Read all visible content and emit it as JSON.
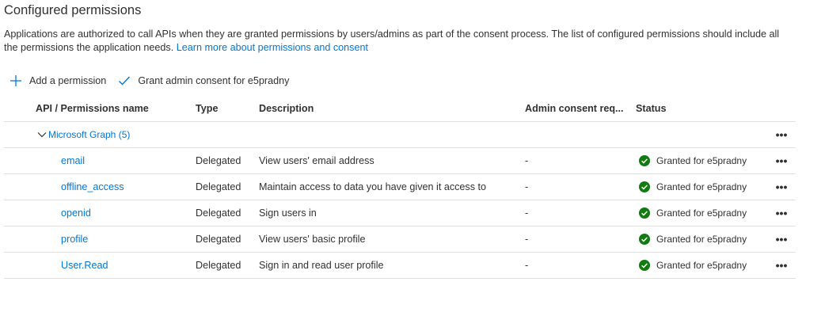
{
  "section": {
    "title": "Configured permissions",
    "description": "Applications are authorized to call APIs when they are granted permissions by users/admins as part of the consent process. The list of configured permissions should include all the permissions the application needs.",
    "learn_more_link": "Learn more about permissions and consent"
  },
  "toolbar": {
    "add_label": "Add a permission",
    "grant_label": "Grant admin consent for e5pradny",
    "add_icon": "plus-icon",
    "grant_icon": "checkmark-icon"
  },
  "table": {
    "columns": [
      "API / Permissions name",
      "Type",
      "Description",
      "Admin consent req...",
      "Status"
    ],
    "group": {
      "label": "Microsoft Graph (5)"
    },
    "more_glyph": "•••",
    "rows": [
      {
        "name": "email",
        "type": "Delegated",
        "description": "View users' email address",
        "admin": "-",
        "status": "Granted for e5pradny"
      },
      {
        "name": "offline_access",
        "type": "Delegated",
        "description": "Maintain access to data you have given it access to",
        "admin": "-",
        "status": "Granted for e5pradny"
      },
      {
        "name": "openid",
        "type": "Delegated",
        "description": "Sign users in",
        "admin": "-",
        "status": "Granted for e5pradny"
      },
      {
        "name": "profile",
        "type": "Delegated",
        "description": "View users' basic profile",
        "admin": "-",
        "status": "Granted for e5pradny"
      },
      {
        "name": "User.Read",
        "type": "Delegated",
        "description": "Sign in and read user profile",
        "admin": "-",
        "status": "Granted for e5pradny"
      }
    ]
  },
  "colors": {
    "link": "#0078d4",
    "success": "#107c10",
    "text": "#323130",
    "divider": "#e1dfdd"
  }
}
